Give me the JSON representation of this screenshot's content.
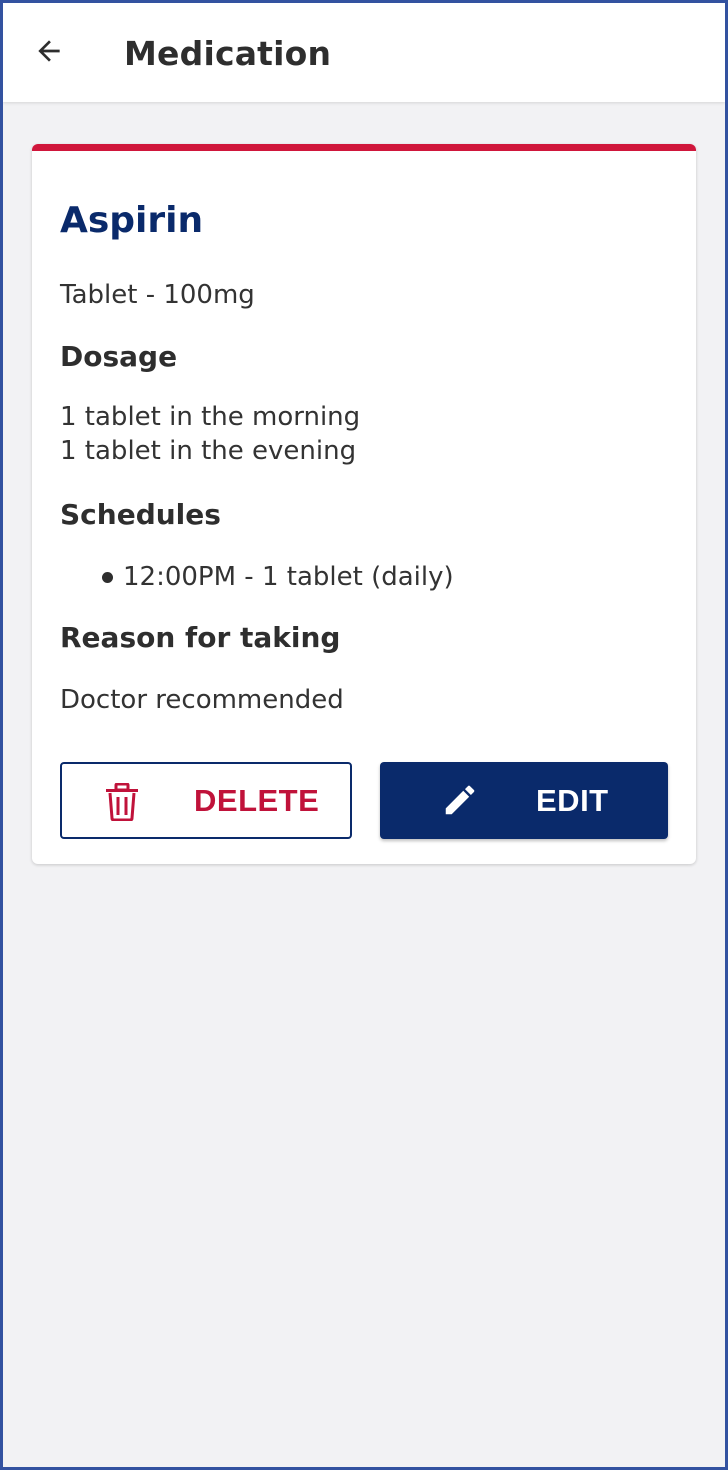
{
  "app_bar": {
    "back_icon": "arrow-left-icon",
    "title": "Medication"
  },
  "medication": {
    "name": "Aspirin",
    "form_strength": "Tablet - 100mg",
    "dosage": {
      "heading": "Dosage",
      "lines": [
        "1 tablet in the morning",
        "1 tablet in the evening"
      ]
    },
    "schedules": {
      "heading": "Schedules",
      "items": [
        "12:00PM - 1 tablet (daily)"
      ]
    },
    "reason": {
      "heading": "Reason for taking",
      "text": "Doctor recommended"
    }
  },
  "actions": {
    "delete_label": "DELETE",
    "delete_icon": "trash-icon",
    "edit_label": "EDIT",
    "edit_icon": "pencil-icon"
  },
  "colors": {
    "accent_red": "#d0163b",
    "brand_navy": "#0a2a6b",
    "frame_border": "#3352a0",
    "background": "#f2f2f4"
  }
}
